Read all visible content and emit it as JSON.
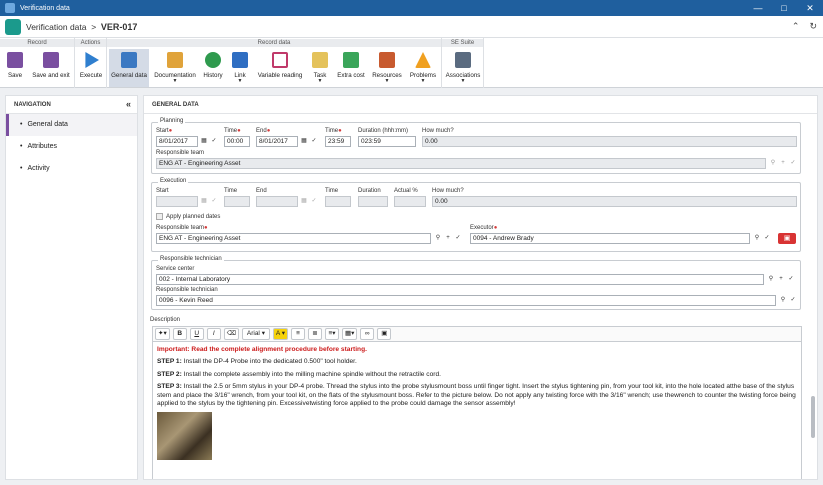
{
  "window": {
    "title": "Verification data"
  },
  "header": {
    "app": "Verification data",
    "separator": ">",
    "record": "VER-017"
  },
  "ribbon": {
    "groups": [
      "Record",
      "Actions",
      "Record data",
      "SE Suite"
    ],
    "buttons": [
      "Save",
      "Save and exit",
      "Execute",
      "General data",
      "Documentation",
      "History",
      "Link",
      "Variable reading",
      "Task",
      "Extra cost",
      "Resources",
      "Problems",
      "Associations"
    ]
  },
  "nav": {
    "title": "NAVIGATION",
    "items": [
      "General data",
      "Attributes",
      "Activity"
    ]
  },
  "main": {
    "title": "GENERAL DATA"
  },
  "planning": {
    "legend": "Planning",
    "start_label": "Start",
    "start": "8/01/2017",
    "time_label": "Time",
    "time1": "00:00",
    "end_label": "End",
    "end": "8/01/2017",
    "time2_label": "Time",
    "time2": "23:59",
    "duration_label": "Duration (hhh:mm)",
    "duration": "023:59",
    "how_much_label": "How much?",
    "how_much": "0.00",
    "team_label": "Responsible team",
    "team": "ENG AT - Engineering Asset"
  },
  "execution": {
    "legend": "Execution",
    "start_label": "Start",
    "time_label": "Time",
    "end_label": "End",
    "time2_label": "Time",
    "duration_label": "Duration",
    "actual_label": "Actual %",
    "how_much_label": "How much?",
    "how_much": "0.00",
    "apply_label": "Apply planned dates",
    "team_label": "Responsible team",
    "team": "ENG AT - Engineering Asset",
    "executor_label": "Executor",
    "executor": "0094 - Andrew Brady"
  },
  "technician": {
    "legend": "Responsible technician",
    "center_label": "Service center",
    "center": "002 - Internal Laboratory",
    "tech_label": "Responsible technician",
    "tech": "0096 - Kevin Reed"
  },
  "description": {
    "label": "Description",
    "font": "Arial",
    "important": "Important: Read the complete alignment procedure before starting.",
    "step1_label": "STEP 1:",
    "step1": "Install the DP-4 Probe into the dedicated 0.500\" tool holder.",
    "step2_label": "STEP 2:",
    "step2": "Install the complete assembly into the milling machine spindle without the retractile cord.",
    "step3_label": "STEP 3:",
    "step3": "Install the 2.5 or 5mm stylus in your DP-4 probe. Thread the stylus into the probe stylusmount boss until finger tight. Insert the stylus tightening pin, from your tool kit, into the hole located atthe base of the stylus stem and place the 3/16\" wrench, from your tool kit, on the flats of the stylusmount boss. Refer to the picture below. Do not apply any twisting force with the 3/16\" wrench; use thewrench to counter the twisting force being applied to the stylus by the tightening pin. Excessivetwisting force applied to the probe could damage the sensor assembly!"
  }
}
